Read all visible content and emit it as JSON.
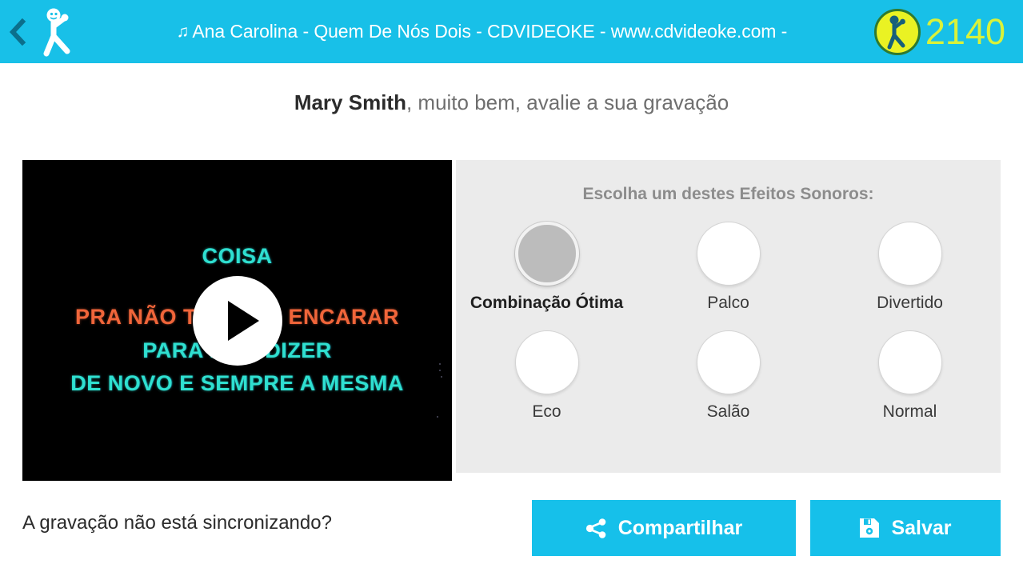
{
  "header": {
    "back_icon": "chevron-left-icon",
    "logo_icon": "karaoke-singer-logo-icon",
    "note_glyph": "♫",
    "title": "Ana Carolina - Quem De Nós Dois - CDVIDEOKE - www.cdvideoke.com -",
    "score": "2140",
    "score_icon": "score-coin-icon",
    "bg_color": "#18c0e8",
    "score_text_color": "#d9f23a",
    "coin_color": "#eaf223"
  },
  "prompt": {
    "user_name": "Mary Smith",
    "message": ", muito bem, avalie a sua gravação"
  },
  "video": {
    "play_icon": "play-button-icon",
    "lyrics": [
      {
        "text": "COISA",
        "color": "cyan"
      },
      {
        "text": "PRA NÃO TER QUE ENCARAR",
        "color": "orange"
      },
      {
        "text": "PARA NÃO DIZER",
        "color": "cyan"
      },
      {
        "text": "DE NOVO E SEMPRE A MESMA",
        "color": "cyan"
      }
    ],
    "lyric_cyan_color": "#2fe0d0",
    "lyric_orange_color": "#f0653a"
  },
  "effects": {
    "heading": "Escolha um destes Efeitos Sonoros:",
    "selected": "Combinação Ótima",
    "options": [
      {
        "label": "Combinação Ótima",
        "selected": true
      },
      {
        "label": "Palco",
        "selected": false
      },
      {
        "label": "Divertido",
        "selected": false
      },
      {
        "label": "Eco",
        "selected": false
      },
      {
        "label": "Salão",
        "selected": false
      },
      {
        "label": "Normal",
        "selected": false
      }
    ],
    "panel_bg": "#ebebeb",
    "heading_color": "#8c8c8c"
  },
  "footer": {
    "sync_question": "A gravação não está sincronizando?",
    "share_label": "Compartilhar",
    "share_icon": "share-icon",
    "save_label": "Salvar",
    "save_icon": "floppy-disk-save-icon",
    "button_color": "#16c0ea"
  }
}
